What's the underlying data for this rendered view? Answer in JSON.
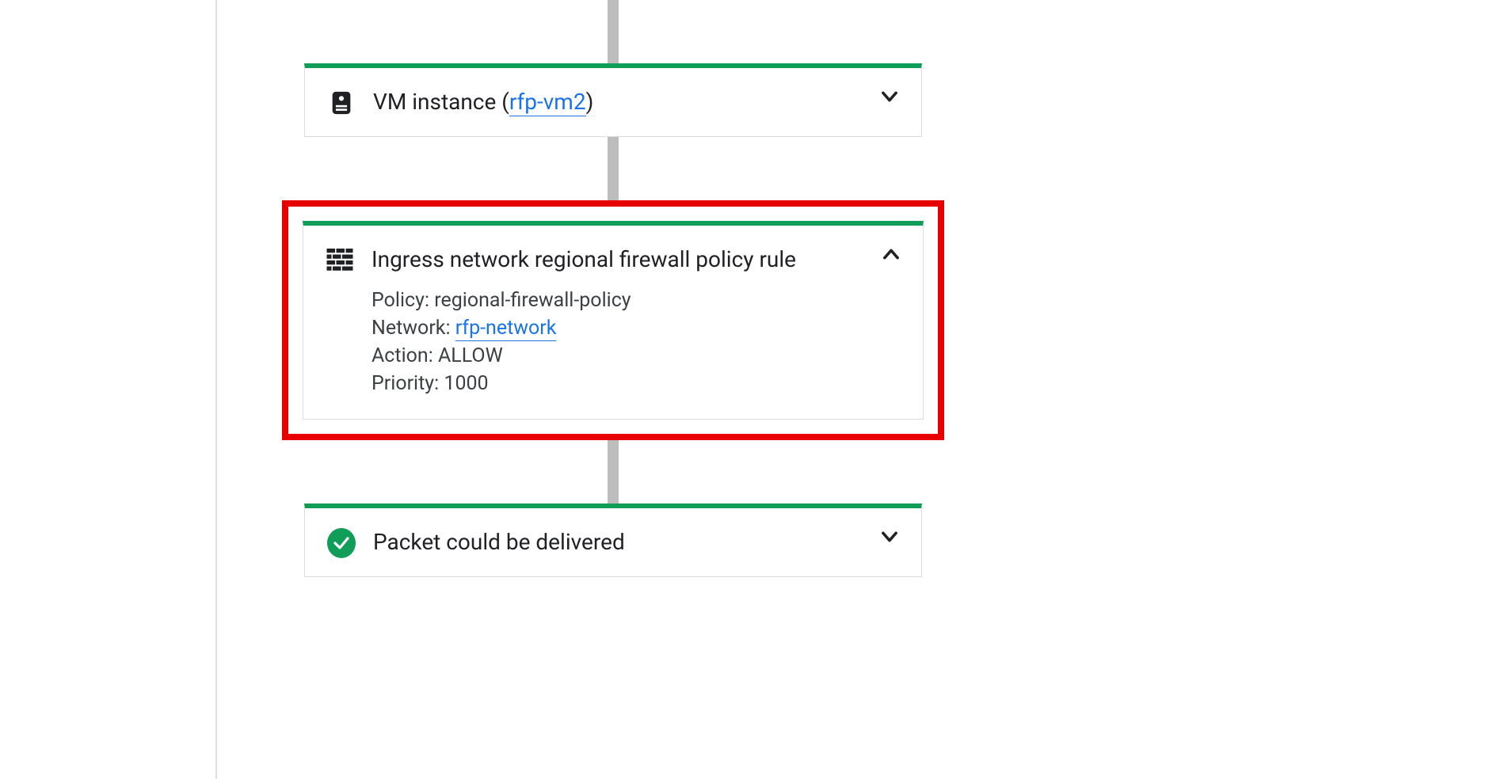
{
  "colors": {
    "accent": "#0f9d58",
    "link": "#1a73e8",
    "highlight": "#e60000",
    "connector": "#bdbdbd",
    "border": "#dadce0"
  },
  "flow": {
    "vm_card": {
      "title_prefix": "VM instance (",
      "link_text": "rfp-vm2",
      "title_suffix": ")",
      "expanded": false
    },
    "firewall_card": {
      "title": "Ingress network regional firewall policy rule",
      "expanded": true,
      "highlighted": true,
      "details": {
        "policy_label": "Policy: ",
        "policy_value": "regional-firewall-policy",
        "network_label": "Network: ",
        "network_link": "rfp-network",
        "action_label": "Action: ",
        "action_value": "ALLOW",
        "priority_label": "Priority: ",
        "priority_value": "1000"
      }
    },
    "delivery_card": {
      "title": "Packet could be delivered",
      "expanded": false
    }
  }
}
